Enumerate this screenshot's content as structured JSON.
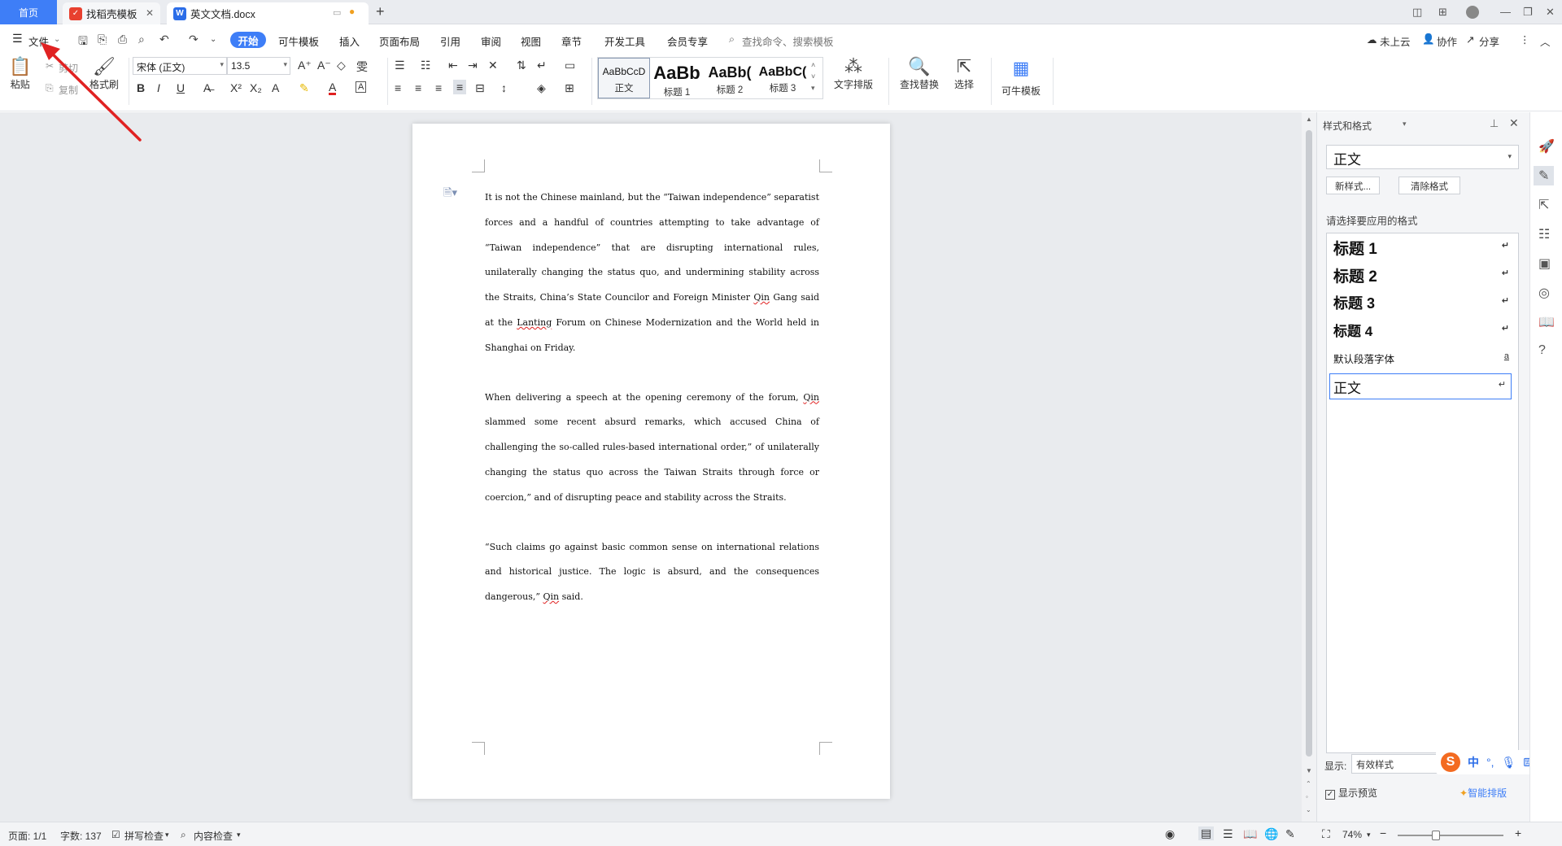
{
  "titlebar": {
    "home_tab": "首页",
    "tabs": [
      {
        "label": "找稻壳模板",
        "icon": "docer-icon",
        "color": "#e8402f"
      },
      {
        "label": "英文文档.docx",
        "icon": "wps-writer-icon",
        "color": "#2b6de8"
      }
    ],
    "new_tab": "+"
  },
  "menubar": {
    "file": "文件",
    "tabs": [
      "开始",
      "可牛模板",
      "插入",
      "页面布局",
      "引用",
      "审阅",
      "视图",
      "章节",
      "开发工具",
      "会员专享"
    ],
    "search_placeholder": "查找命令、搜索模板",
    "right": [
      "未上云",
      "协作",
      "分享"
    ]
  },
  "ribbon": {
    "paste": "粘贴",
    "cut": "剪切",
    "copy": "复制",
    "format_painter": "格式刷",
    "font_name": "宋体 (正文)",
    "font_size": "13.5",
    "styles": [
      {
        "preview": "AaBbCcD",
        "name": "正文"
      },
      {
        "preview": "AaBb",
        "name": "标题 1"
      },
      {
        "preview": "AaBb(",
        "name": "标题 2"
      },
      {
        "preview": "AaBbC(",
        "name": "标题 3"
      }
    ],
    "text_layout": "文字排版",
    "find_replace": "查找替换",
    "select": "选择",
    "kn_template": "可牛模板"
  },
  "document": {
    "paragraphs": [
      "It is not the Chinese mainland, but the “Taiwan independence” separatist forces and a handful of countries attempting to take advantage of “Taiwan independence” that are disrupting international rules, unilaterally changing the status quo, and undermining stability across the Straits, China’s State Councilor and Foreign Minister Qin Gang said at the Lanting Forum on Chinese Modernization and the World held in Shanghai on Friday.",
      "When delivering a speech at the opening ceremony of the forum, Qin slammed some recent absurd remarks, which accused China of challenging the so-called rules-based international order,” of unilaterally changing the status quo across the Taiwan Straits through force or coercion,” and of disrupting peace and stability across the Straits.",
      "“Such claims go against basic common sense on international relations and historical justice. The logic is absurd, and the consequences dangerous,” Qin said."
    ]
  },
  "panel": {
    "title": "样式和格式",
    "current_style": "正文",
    "new_style": "新样式...",
    "clear_format": "清除格式",
    "hint": "请选择要应用的格式",
    "styles": [
      "标题  1",
      "标题  2",
      "标题  3",
      "标题  4",
      "默认段落字体",
      "正文"
    ],
    "show_label": "显示:",
    "show_value": "有效样式",
    "preview": "显示预览",
    "smart_layout": "智能排版"
  },
  "statusbar": {
    "page": "页面: 1/1",
    "words": "字数: 137",
    "spell": "拼写检查",
    "content": "内容检查",
    "zoom": "74%"
  },
  "colors": {
    "accent": "#3e7ef7",
    "arrow": "#e02222"
  }
}
